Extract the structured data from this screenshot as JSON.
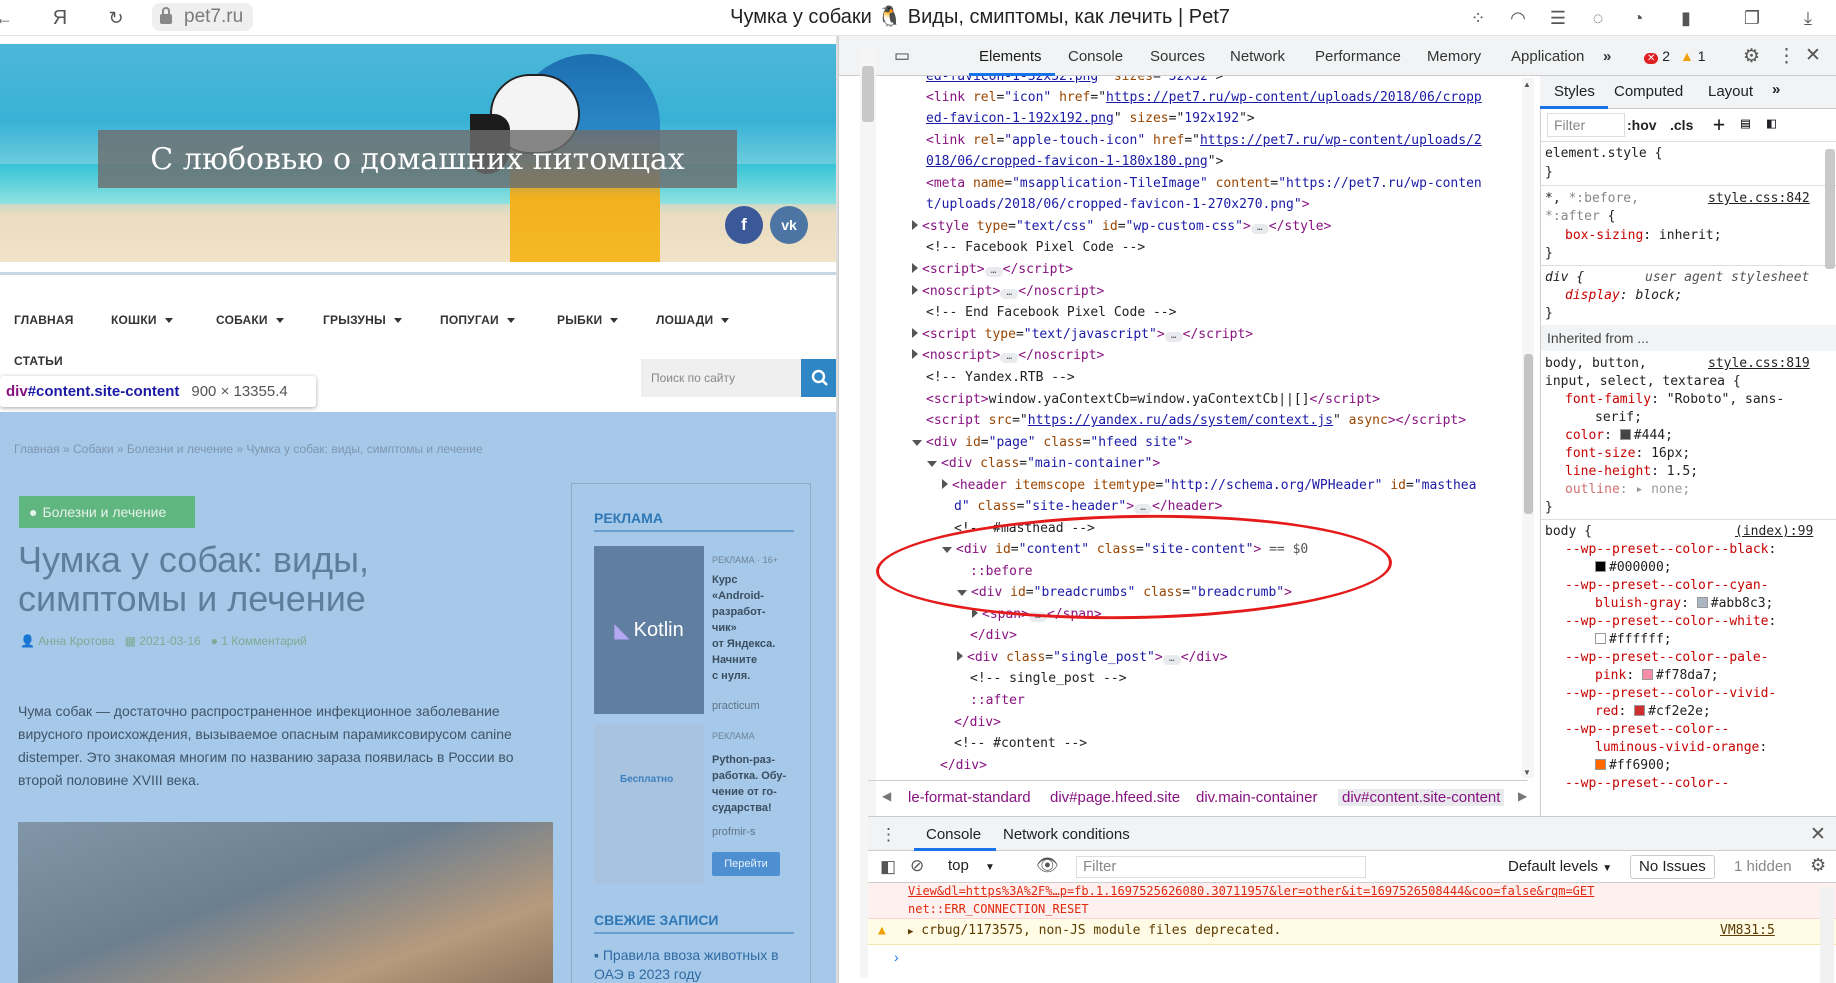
{
  "browser": {
    "url": "pet7.ru",
    "title": "Чумка у собаки 🐧 Виды, смиптомы, как лечить | Pet7"
  },
  "site": {
    "banner": "С любовью о домашних питомцах",
    "social": {
      "facebook": "f",
      "vk": "vk"
    },
    "nav": [
      "ГЛАВНАЯ",
      "КОШКИ",
      "СОБАКИ",
      "ГРЫЗУНЫ",
      "ПОПУГАИ",
      "РЫБКИ",
      "ЛОШАДИ",
      "СТАТЬИ"
    ],
    "search_placeholder": "Поиск по сайту",
    "inspect_tooltip": {
      "tag": "div",
      "selector": "#content.site-content",
      "size": "900 × 13355.4"
    },
    "breadcrumbs": "Главная » Собаки » Болезни и лечение » Чумка у собак: виды, симптомы и лечение",
    "category": "Болезни и лечение",
    "article_title": "Чумка у собак: виды, симптомы и лечение",
    "author": "Анна Кротова",
    "date": "2021-03-16",
    "comments": "1 Комментарий",
    "lead": "Чума собак — достаточно распространенное инфекционное заболевание вирусного происхождения, вызываемое опасным парамиксовирусом canine distemper. Это знакомая многим по названию зараза появилась в России во второй половине XVIII века.",
    "sidebar": {
      "ads_heading": "РЕКЛАМА",
      "ad1": {
        "label": "РЕКЛАМА · 16+",
        "brand": "Kotlin",
        "text": [
          "Курс",
          "«Android-",
          "разработ-",
          "чик»",
          "от Яндекса.",
          "Начните",
          "с нуля."
        ],
        "source": "practicum"
      },
      "ad2": {
        "label": "РЕКЛАМА",
        "text": [
          "Python-раз-",
          "работка. Обу-",
          "чение от го-",
          "сударства!"
        ],
        "source": "profmir-s",
        "promo": "Бесплатно",
        "button": "Перейти"
      },
      "recent_heading": "СВЕЖИЕ ЗАПИСИ",
      "recent_item": "Правила ввоза животных в ОАЭ в 2023 году"
    }
  },
  "devtools": {
    "tabs": [
      "Elements",
      "Console",
      "Sources",
      "Network",
      "Performance",
      "Memory",
      "Application"
    ],
    "errors": "2",
    "warnings": "1",
    "dom": {
      "l1": "ed-favicon-1-32x32.png",
      "l1b": "32x32",
      "l2_href": "https://pet7.ru/wp-content/uploads/2018/06/cropp",
      "l3": "ed-favicon-1-192x192.png",
      "l3b": "192x192",
      "l4_href": "https://pet7.ru/wp-content/uploads/2",
      "l5": "018/06/cropped-favicon-1-180x180.png",
      "l6_content": "\"https://pet7.ru/wp-conten",
      "l7": "t/uploads/2018/06/cropped-favicon-1-270x270.png\"",
      "c_fb": "<!-- Facebook Pixel Code -->",
      "c_fb_end": "<!-- End Facebook Pixel Code -->",
      "c_rtb": "<!-- Yandex.RTB -->",
      "rtb_script": "window.yaContextCb=window.yaContextCb||[]",
      "ya_src": "https://yandex.ru/ads/system/context.js",
      "masthead": "<!-- #masthead -->",
      "selected_suffix": "== $0",
      "before": "::before",
      "after": "::after",
      "single_post_c": "<!-- single_post -->",
      "content_c": "<!-- #content -->"
    },
    "crumbs": [
      "le-format-standard",
      "div#page.hfeed.site",
      "div.main-container",
      "div#content.site-content"
    ],
    "styles_tabs": [
      "Styles",
      "Computed",
      "Layout"
    ],
    "styles": {
      "filter": "Filter",
      "hov": ":hov",
      "cls": ".cls",
      "element_style": "element.style {",
      "src1": "style.css:842",
      "ua": "user agent stylesheet",
      "inherited": "Inherited from ...",
      "src2": "style.css:819",
      "src3": "(index):99"
    },
    "drawer_tabs": [
      "Console",
      "Network conditions"
    ],
    "console": {
      "context": "top",
      "filter": "Filter",
      "levels": "Default levels",
      "issues": "No Issues",
      "hidden": "1 hidden",
      "err1": "View&dl=https%3A%2F%…p=fb.1.1697525626080.30711957&ler=other&it=1697526508444&coo=false&rqm=GET",
      "err2": "net::ERR_CONNECTION_RESET",
      "warn": "crbug/1173575, non-JS module files deprecated.",
      "warn_src": "VM831:5"
    }
  }
}
